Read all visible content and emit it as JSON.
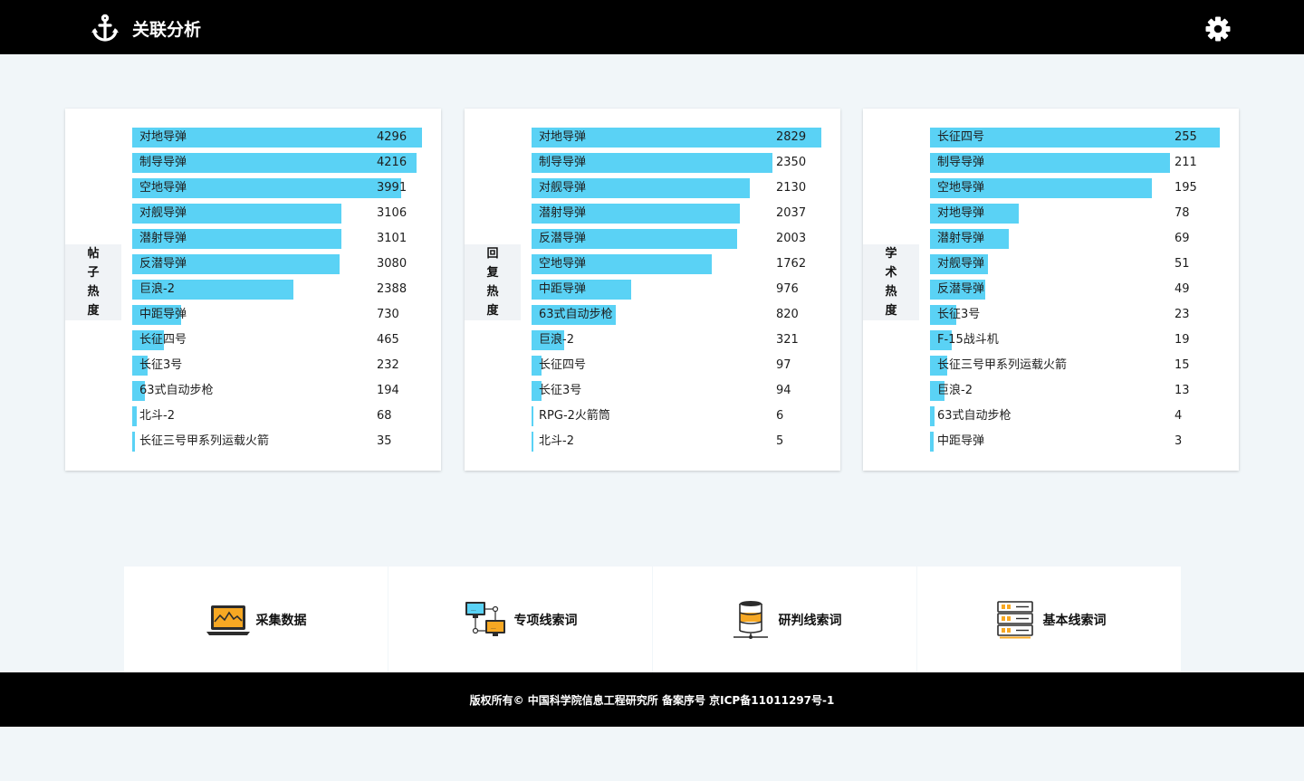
{
  "header": {
    "title": "关联分析",
    "logo_icon": "anchor-icon",
    "settings_icon": "gear-icon"
  },
  "colors": {
    "topbar": "#000000",
    "bar": "#5ad2f5",
    "background": "#f1f6f9"
  },
  "chart_data": [
    {
      "type": "bar",
      "orientation": "horizontal",
      "title": "帖子热度",
      "categories": [
        "对地导弹",
        "制导导弹",
        "空地导弹",
        "对舰导弹",
        "潜射导弹",
        "反潜导弹",
        "巨浪-2",
        "中距导弹",
        "长征四号",
        "长征3号",
        "63式自动步枪",
        "北斗-2",
        "长征三号甲系列运载火箭"
      ],
      "values": [
        4296,
        4216,
        3991,
        3106,
        3101,
        3080,
        2388,
        730,
        465,
        232,
        194,
        68,
        35
      ],
      "max": 4296
    },
    {
      "type": "bar",
      "orientation": "horizontal",
      "title": "回复热度",
      "categories": [
        "对地导弹",
        "制导导弹",
        "对舰导弹",
        "潜射导弹",
        "反潜导弹",
        "空地导弹",
        "中距导弹",
        "63式自动步枪",
        "巨浪-2",
        "长征四号",
        "长征3号",
        "RPG-2火箭筒",
        "北斗-2"
      ],
      "values": [
        2829,
        2350,
        2130,
        2037,
        2003,
        1762,
        976,
        820,
        321,
        97,
        94,
        6,
        5
      ],
      "max": 2829
    },
    {
      "type": "bar",
      "orientation": "horizontal",
      "title": "学术热度",
      "categories": [
        "长征四号",
        "制导导弹",
        "空地导弹",
        "对地导弹",
        "潜射导弹",
        "对舰导弹",
        "反潜导弹",
        "长征3号",
        "F-15战斗机",
        "长征三号甲系列运载火箭",
        "巨浪-2",
        "63式自动步枪",
        "中距导弹"
      ],
      "values": [
        255,
        211,
        195,
        78,
        69,
        51,
        49,
        23,
        19,
        15,
        13,
        4,
        3
      ],
      "max": 255
    }
  ],
  "features": [
    {
      "label": "采集数据",
      "icon": "laptop-chart-icon"
    },
    {
      "label": "专项线索词",
      "icon": "network-monitors-icon"
    },
    {
      "label": "研判线索词",
      "icon": "database-icon"
    },
    {
      "label": "基本线索词",
      "icon": "server-rack-icon"
    }
  ],
  "footer": {
    "text": "版权所有© 中国科学院信息工程研究所 备案序号 京ICP备11011297号-1"
  }
}
